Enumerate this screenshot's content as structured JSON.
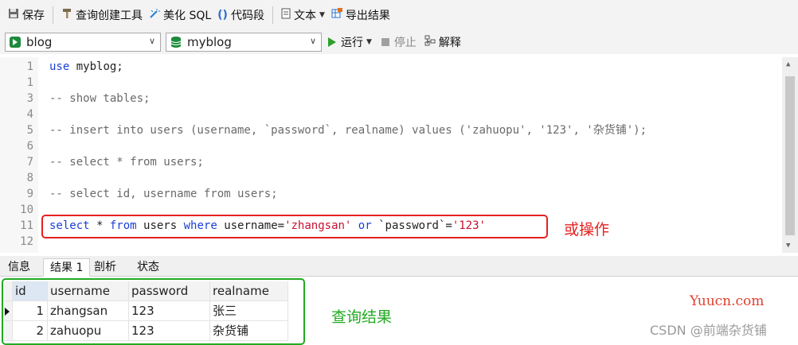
{
  "toolbar": {
    "save": "保存",
    "query_builder": "查询创建工具",
    "beautify": "美化 SQL",
    "snippet": "代码段",
    "text": "文本",
    "export": "导出结果"
  },
  "connection_bar": {
    "connection": "blog",
    "database": "myblog",
    "run": "运行",
    "stop": "停止",
    "explain": "解释"
  },
  "editor": {
    "lines": [
      {
        "n": "1",
        "parts": [
          {
            "t": "use",
            "c": "kw"
          },
          {
            "t": " myblog;",
            "c": "plain"
          }
        ]
      },
      {
        "n": "1",
        "parts": []
      },
      {
        "n": "3",
        "parts": [
          {
            "t": "-- show tables;",
            "c": "cm"
          }
        ]
      },
      {
        "n": "4",
        "parts": []
      },
      {
        "n": "5",
        "parts": [
          {
            "t": "-- insert into users (username, `password`, realname) values ('zahuopu', '123', '杂货铺');",
            "c": "cm"
          }
        ]
      },
      {
        "n": "6",
        "parts": []
      },
      {
        "n": "7",
        "parts": [
          {
            "t": "-- select * from users;",
            "c": "cm"
          }
        ]
      },
      {
        "n": "8",
        "parts": []
      },
      {
        "n": "9",
        "parts": [
          {
            "t": "-- select id, username from users;",
            "c": "cm"
          }
        ]
      },
      {
        "n": "10",
        "parts": []
      },
      {
        "n": "11",
        "parts": [
          {
            "t": "select",
            "c": "kw"
          },
          {
            "t": " * ",
            "c": "plain"
          },
          {
            "t": "from",
            "c": "kw"
          },
          {
            "t": " users ",
            "c": "plain"
          },
          {
            "t": "where",
            "c": "kw"
          },
          {
            "t": " username=",
            "c": "plain"
          },
          {
            "t": "'zhangsan'",
            "c": "str"
          },
          {
            "t": " ",
            "c": "plain"
          },
          {
            "t": "or",
            "c": "kw"
          },
          {
            "t": " `password`=",
            "c": "plain"
          },
          {
            "t": "'123'",
            "c": "str"
          }
        ]
      },
      {
        "n": "12",
        "parts": []
      }
    ]
  },
  "annotations": {
    "or_operation": "或操作",
    "query_result": "查询结果"
  },
  "tabs": [
    "信息",
    "结果 1",
    "剖析",
    "状态"
  ],
  "active_tab": "结果 1",
  "result": {
    "columns": [
      "id",
      "username",
      "password",
      "realname"
    ],
    "rows": [
      [
        "1",
        "zhangsan",
        "123",
        "张三"
      ],
      [
        "2",
        "zahuopu",
        "123",
        "杂货铺"
      ]
    ]
  },
  "watermarks": {
    "site": "Yuucn.com",
    "csdn": "CSDN @前端杂货铺"
  },
  "colors": {
    "keyword": "#1a3fd6",
    "string": "#c8102e",
    "comment": "#6a6a6a",
    "red_annotation": "#e62020",
    "green_annotation": "#22aa22"
  }
}
